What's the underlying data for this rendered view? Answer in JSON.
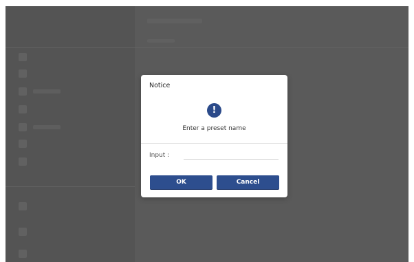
{
  "dialog": {
    "title": "Notice",
    "icon": "exclamation-icon",
    "icon_glyph": "!",
    "message": "Enter a preset name",
    "input_label": "Input :",
    "input_value": "",
    "ok_label": "OK",
    "cancel_label": "Cancel"
  },
  "colors": {
    "overlay": "#5a5a5a",
    "button": "#2d4e8e",
    "icon": "#2b4a8a",
    "dialog_bg": "#ffffff"
  }
}
